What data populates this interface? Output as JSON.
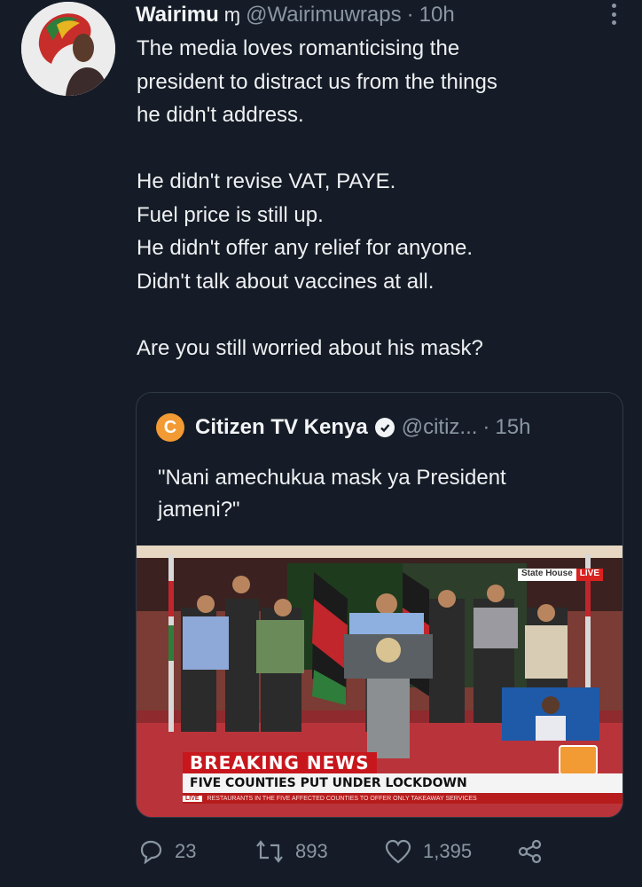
{
  "tweet": {
    "author_name": "Wairimu",
    "author_emoji": "ɱ",
    "handle": "@Wairimuwraps",
    "separator": "·",
    "time": "10h",
    "lines": [
      "The media loves romanticising the",
      "president to distract us from the things",
      "he didn't address.",
      "",
      "He didn't revise VAT, PAYE.",
      "Fuel price is still up.",
      "He didn't offer any relief for anyone.",
      "Didn't talk about vaccines at all.",
      "",
      "Are you still worried about his mask?"
    ]
  },
  "quote": {
    "author_name": "Citizen TV Kenya",
    "handle": "@citiz...",
    "separator": "·",
    "time": "15h",
    "logo_letter": "C",
    "text_line1": "\"Nani amechukua mask ya President",
    "text_line2": "jameni?\"",
    "media": {
      "corner_tag": "State House",
      "live_tag": "LIVE",
      "breaking": "BREAKING NEWS",
      "headline": "FIVE COUNTIES PUT UNDER LOCKDOWN",
      "ticker_badge": "LIVE",
      "ticker": "RESTAURANTS IN THE FIVE AFFECTED COUNTIES TO OFFER ONLY TAKEAWAY SERVICES"
    }
  },
  "actions": {
    "replies": "23",
    "retweets": "893",
    "likes": "1,395"
  },
  "colors": {
    "background": "#151c27",
    "muted": "#8a96a3",
    "text": "#eef0f2",
    "citizen_orange": "#f29a33",
    "breaking_red": "#c7171d"
  }
}
